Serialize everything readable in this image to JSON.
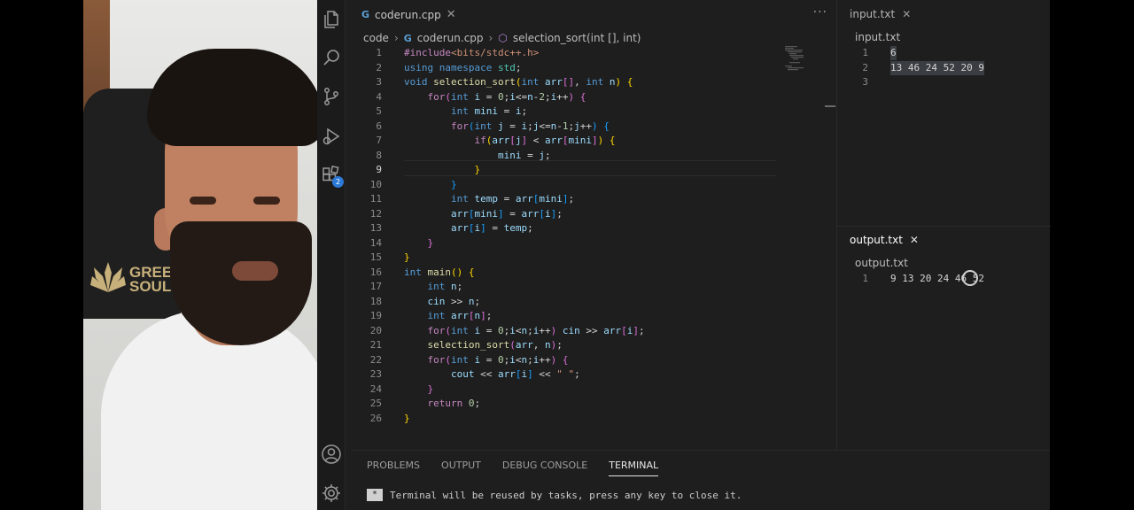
{
  "webcam": {
    "logo_text": "GREE\nSOUL"
  },
  "activity_bar": {
    "icons": [
      "files-icon",
      "search-icon",
      "source-control-icon",
      "run-debug-icon",
      "extensions-icon",
      "account-icon",
      "settings-gear-icon"
    ],
    "extensions_badge": "2"
  },
  "editor": {
    "tab_title": "coderun.cpp",
    "more_label": "···",
    "breadcrumb": {
      "folder": "code",
      "file": "coderun.cpp",
      "symbol": "selection_sort(int [], int)"
    },
    "current_line": 9,
    "lines": [
      [
        [
          "pre",
          "#include"
        ],
        [
          "inc",
          "<bits/stdc++.h>"
        ]
      ],
      [
        [
          "kw",
          "using"
        ],
        [
          "op",
          " "
        ],
        [
          "kw",
          "namespace"
        ],
        [
          "op",
          " "
        ],
        [
          "ty",
          "std"
        ],
        [
          "op",
          ";"
        ]
      ],
      [
        [
          "kw",
          "void"
        ],
        [
          "op",
          " "
        ],
        [
          "fn",
          "selection_sort"
        ],
        [
          "b1",
          "("
        ],
        [
          "kw",
          "int"
        ],
        [
          "op",
          " "
        ],
        [
          "vr",
          "arr"
        ],
        [
          "b2",
          "[]"
        ],
        [
          "op",
          ", "
        ],
        [
          "kw",
          "int"
        ],
        [
          "op",
          " "
        ],
        [
          "vr",
          "n"
        ],
        [
          "b1",
          ")"
        ],
        [
          "op",
          " "
        ],
        [
          "b1",
          "{"
        ]
      ],
      [
        [
          "op",
          "    "
        ],
        [
          "ctl",
          "for"
        ],
        [
          "b2",
          "("
        ],
        [
          "kw",
          "int"
        ],
        [
          "op",
          " "
        ],
        [
          "vr",
          "i"
        ],
        [
          "op",
          " = "
        ],
        [
          "num",
          "0"
        ],
        [
          "op",
          ";"
        ],
        [
          "vr",
          "i"
        ],
        [
          "op",
          "<="
        ],
        [
          "vr",
          "n"
        ],
        [
          "op",
          "-"
        ],
        [
          "num",
          "2"
        ],
        [
          "op",
          ";"
        ],
        [
          "vr",
          "i"
        ],
        [
          "op",
          "++"
        ],
        [
          "b2",
          ")"
        ],
        [
          "op",
          " "
        ],
        [
          "b2",
          "{"
        ]
      ],
      [
        [
          "op",
          "        "
        ],
        [
          "kw",
          "int"
        ],
        [
          "op",
          " "
        ],
        [
          "vr",
          "mini"
        ],
        [
          "op",
          " = "
        ],
        [
          "vr",
          "i"
        ],
        [
          "op",
          ";"
        ]
      ],
      [
        [
          "op",
          "        "
        ],
        [
          "ctl",
          "for"
        ],
        [
          "b3",
          "("
        ],
        [
          "kw",
          "int"
        ],
        [
          "op",
          " "
        ],
        [
          "vr",
          "j"
        ],
        [
          "op",
          " = "
        ],
        [
          "vr",
          "i"
        ],
        [
          "op",
          ";"
        ],
        [
          "vr",
          "j"
        ],
        [
          "op",
          "<="
        ],
        [
          "vr",
          "n"
        ],
        [
          "op",
          "-"
        ],
        [
          "num",
          "1"
        ],
        [
          "op",
          ";"
        ],
        [
          "vr",
          "j"
        ],
        [
          "op",
          "++"
        ],
        [
          "b3",
          ")"
        ],
        [
          "op",
          " "
        ],
        [
          "b3",
          "{"
        ]
      ],
      [
        [
          "op",
          "            "
        ],
        [
          "ctl",
          "if"
        ],
        [
          "b1",
          "("
        ],
        [
          "vr",
          "arr"
        ],
        [
          "b2",
          "["
        ],
        [
          "vr",
          "j"
        ],
        [
          "b2",
          "]"
        ],
        [
          "op",
          " < "
        ],
        [
          "vr",
          "arr"
        ],
        [
          "b2",
          "["
        ],
        [
          "vr",
          "mini"
        ],
        [
          "b2",
          "]"
        ],
        [
          "b1",
          ")"
        ],
        [
          "op",
          " "
        ],
        [
          "b1",
          "{"
        ]
      ],
      [
        [
          "op",
          "                "
        ],
        [
          "vr",
          "mini"
        ],
        [
          "op",
          " = "
        ],
        [
          "vr",
          "j"
        ],
        [
          "op",
          ";"
        ]
      ],
      [
        [
          "op",
          "            "
        ],
        [
          "b1",
          "}"
        ]
      ],
      [
        [
          "op",
          "        "
        ],
        [
          "b3",
          "}"
        ]
      ],
      [
        [
          "op",
          "        "
        ],
        [
          "kw",
          "int"
        ],
        [
          "op",
          " "
        ],
        [
          "vr",
          "temp"
        ],
        [
          "op",
          " = "
        ],
        [
          "vr",
          "arr"
        ],
        [
          "b3",
          "["
        ],
        [
          "vr",
          "mini"
        ],
        [
          "b3",
          "]"
        ],
        [
          "op",
          ";"
        ]
      ],
      [
        [
          "op",
          "        "
        ],
        [
          "vr",
          "arr"
        ],
        [
          "b3",
          "["
        ],
        [
          "vr",
          "mini"
        ],
        [
          "b3",
          "]"
        ],
        [
          "op",
          " = "
        ],
        [
          "vr",
          "arr"
        ],
        [
          "b3",
          "["
        ],
        [
          "vr",
          "i"
        ],
        [
          "b3",
          "]"
        ],
        [
          "op",
          ";"
        ]
      ],
      [
        [
          "op",
          "        "
        ],
        [
          "vr",
          "arr"
        ],
        [
          "b3",
          "["
        ],
        [
          "vr",
          "i"
        ],
        [
          "b3",
          "]"
        ],
        [
          "op",
          " = "
        ],
        [
          "vr",
          "temp"
        ],
        [
          "op",
          ";"
        ]
      ],
      [
        [
          "op",
          "    "
        ],
        [
          "b2",
          "}"
        ]
      ],
      [
        [
          "b1",
          "}"
        ]
      ],
      [
        [
          "kw",
          "int"
        ],
        [
          "op",
          " "
        ],
        [
          "fn",
          "main"
        ],
        [
          "b1",
          "()"
        ],
        [
          "op",
          " "
        ],
        [
          "b1",
          "{"
        ]
      ],
      [
        [
          "op",
          "    "
        ],
        [
          "kw",
          "int"
        ],
        [
          "op",
          " "
        ],
        [
          "vr",
          "n"
        ],
        [
          "op",
          ";"
        ]
      ],
      [
        [
          "op",
          "    "
        ],
        [
          "vr",
          "cin"
        ],
        [
          "op",
          " >> "
        ],
        [
          "vr",
          "n"
        ],
        [
          "op",
          ";"
        ]
      ],
      [
        [
          "op",
          "    "
        ],
        [
          "kw",
          "int"
        ],
        [
          "op",
          " "
        ],
        [
          "vr",
          "arr"
        ],
        [
          "b2",
          "["
        ],
        [
          "vr",
          "n"
        ],
        [
          "b2",
          "]"
        ],
        [
          "op",
          ";"
        ]
      ],
      [
        [
          "op",
          "    "
        ],
        [
          "ctl",
          "for"
        ],
        [
          "b2",
          "("
        ],
        [
          "kw",
          "int"
        ],
        [
          "op",
          " "
        ],
        [
          "vr",
          "i"
        ],
        [
          "op",
          " = "
        ],
        [
          "num",
          "0"
        ],
        [
          "op",
          ";"
        ],
        [
          "vr",
          "i"
        ],
        [
          "op",
          "<"
        ],
        [
          "vr",
          "n"
        ],
        [
          "op",
          ";"
        ],
        [
          "vr",
          "i"
        ],
        [
          "op",
          "++"
        ],
        [
          "b2",
          ")"
        ],
        [
          "op",
          " "
        ],
        [
          "vr",
          "cin"
        ],
        [
          "op",
          " >> "
        ],
        [
          "vr",
          "arr"
        ],
        [
          "b2",
          "["
        ],
        [
          "vr",
          "i"
        ],
        [
          "b2",
          "]"
        ],
        [
          "op",
          ";"
        ]
      ],
      [
        [
          "op",
          "    "
        ],
        [
          "fn",
          "selection_sort"
        ],
        [
          "b2",
          "("
        ],
        [
          "vr",
          "arr"
        ],
        [
          "op",
          ", "
        ],
        [
          "vr",
          "n"
        ],
        [
          "b2",
          ")"
        ],
        [
          "op",
          ";"
        ]
      ],
      [
        [
          "op",
          "    "
        ],
        [
          "ctl",
          "for"
        ],
        [
          "b2",
          "("
        ],
        [
          "kw",
          "int"
        ],
        [
          "op",
          " "
        ],
        [
          "vr",
          "i"
        ],
        [
          "op",
          " = "
        ],
        [
          "num",
          "0"
        ],
        [
          "op",
          ";"
        ],
        [
          "vr",
          "i"
        ],
        [
          "op",
          "<"
        ],
        [
          "vr",
          "n"
        ],
        [
          "op",
          ";"
        ],
        [
          "vr",
          "i"
        ],
        [
          "op",
          "++"
        ],
        [
          "b2",
          ")"
        ],
        [
          "op",
          " "
        ],
        [
          "b2",
          "{"
        ]
      ],
      [
        [
          "op",
          "        "
        ],
        [
          "vr",
          "cout"
        ],
        [
          "op",
          " << "
        ],
        [
          "vr",
          "arr"
        ],
        [
          "b3",
          "["
        ],
        [
          "vr",
          "i"
        ],
        [
          "b3",
          "]"
        ],
        [
          "op",
          " << "
        ],
        [
          "str",
          "\" \""
        ],
        [
          "op",
          ";"
        ]
      ],
      [
        [
          "op",
          "    "
        ],
        [
          "b2",
          "}"
        ]
      ],
      [
        [
          "op",
          "    "
        ],
        [
          "ctl",
          "return"
        ],
        [
          "op",
          " "
        ],
        [
          "num",
          "0"
        ],
        [
          "op",
          ";"
        ]
      ],
      [
        [
          "b1",
          "}"
        ]
      ]
    ]
  },
  "input_pane": {
    "tab_title": "input.txt",
    "breadcrumb": "input.txt",
    "lines": [
      "6",
      "13 46 24 52 20 9",
      ""
    ]
  },
  "output_pane": {
    "tab_title": "output.txt",
    "breadcrumb": "output.txt",
    "lines": [
      "9 13 20 24 46 52"
    ]
  },
  "panel": {
    "tabs": [
      "PROBLEMS",
      "OUTPUT",
      "DEBUG CONSOLE",
      "TERMINAL"
    ],
    "active_tab": "TERMINAL",
    "terminal_mark": "*",
    "terminal_text": "Terminal will be reused by tasks, press any key to close it."
  }
}
